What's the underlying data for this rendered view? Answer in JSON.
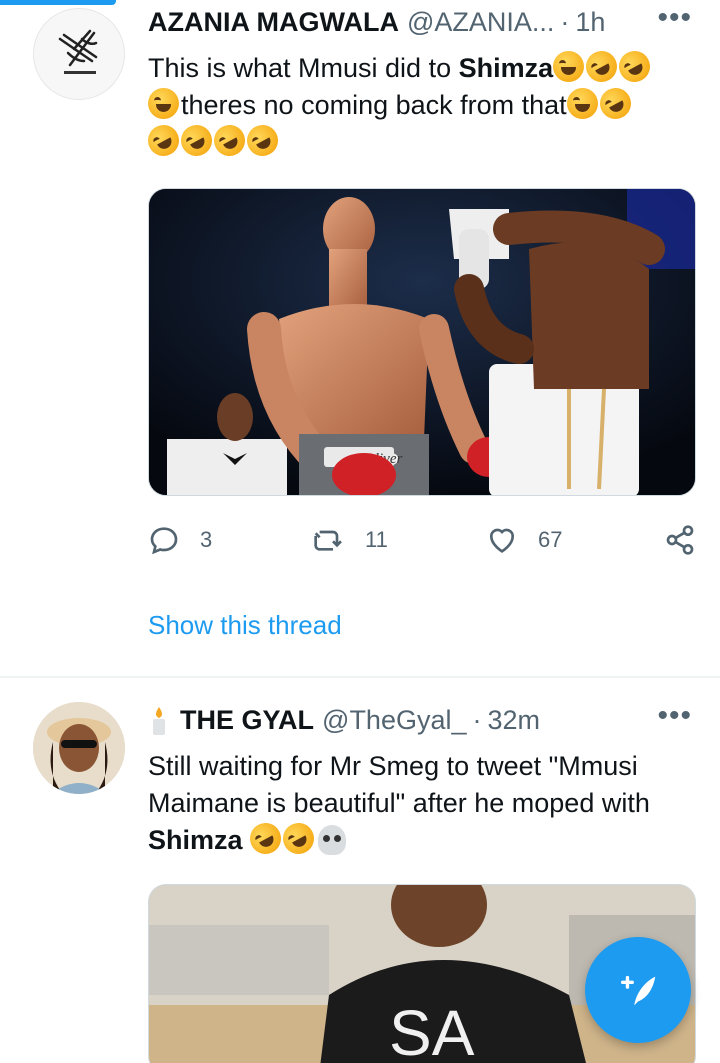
{
  "tweets": [
    {
      "name": "AZANIA MAGWALA",
      "handle": "@AZANIA...",
      "separator": "·",
      "time": "1h",
      "text_line1": "This is what Mmusi did to ",
      "text_bold1": "Shimza",
      "text_line2": "theres no coming back from that",
      "media_alt": "Oliver",
      "replies": "3",
      "retweets": "11",
      "likes": "67",
      "show_thread": "Show this thread"
    },
    {
      "name": "THE GYAL",
      "handle": "@TheGyal_",
      "separator": "·",
      "time": "32m",
      "text_line1": "Still waiting for Mr Smeg to tweet \"Mmusi Maimane is beautiful\"  after he moped with ",
      "text_bold1": "Shimza",
      "media_text": "SA"
    }
  ],
  "icons": {
    "more": "more-horizontal-icon",
    "reply": "reply-icon",
    "retweet": "retweet-icon",
    "like": "heart-icon",
    "share": "share-icon",
    "compose": "compose-tweet-icon",
    "candle": "candle-icon"
  },
  "colors": {
    "accent": "#1d9bf0",
    "secondary_text": "#536471",
    "primary_text": "#0f1419"
  }
}
